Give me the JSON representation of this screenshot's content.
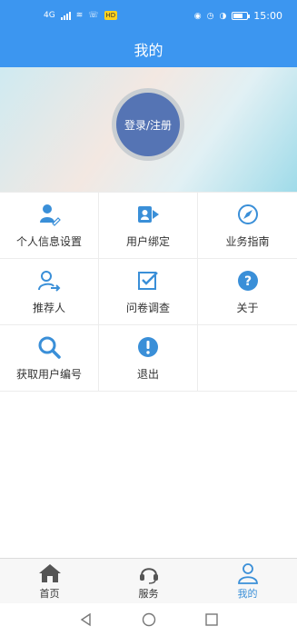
{
  "status_bar": {
    "left_signal": "4G",
    "badge": "HD",
    "time": "15:00"
  },
  "header": {
    "title": "我的"
  },
  "banner": {
    "login_label": "登录/注册"
  },
  "menu": [
    {
      "label": "个人信息设置",
      "icon": "person-edit-icon"
    },
    {
      "label": "用户绑定",
      "icon": "user-bind-icon"
    },
    {
      "label": "业务指南",
      "icon": "compass-icon"
    },
    {
      "label": "推荐人",
      "icon": "user-arrow-icon"
    },
    {
      "label": "问卷调查",
      "icon": "checkbox-icon"
    },
    {
      "label": "关于",
      "icon": "question-icon"
    },
    {
      "label": "获取用户编号",
      "icon": "search-icon"
    },
    {
      "label": "退出",
      "icon": "exclamation-icon"
    }
  ],
  "tabs": [
    {
      "label": "首页",
      "icon": "home-icon",
      "active": false
    },
    {
      "label": "服务",
      "icon": "headset-icon",
      "active": false
    },
    {
      "label": "我的",
      "icon": "user-icon",
      "active": true
    }
  ],
  "colors": {
    "primary": "#3c96f0",
    "icon_blue": "#3a8fd8",
    "login_button": "#5574b4"
  }
}
